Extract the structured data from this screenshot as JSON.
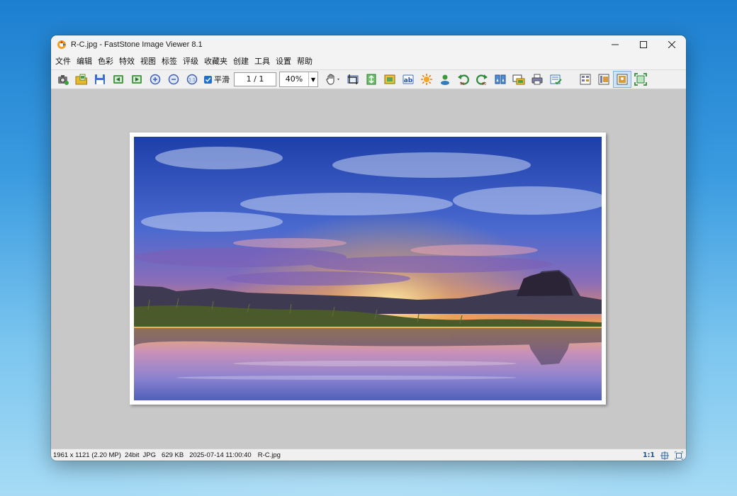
{
  "window": {
    "title": "R-C.jpg  -  FastStone Image Viewer 8.1"
  },
  "menu": [
    "文件",
    "编辑",
    "色彩",
    "特效",
    "视图",
    "标签",
    "评级",
    "收藏夹",
    "创建",
    "工具",
    "设置",
    "帮助"
  ],
  "toolbar": {
    "smooth_label": "平滑",
    "smooth_checked": true,
    "page_indicator": "1 / 1",
    "zoom_value": "40%",
    "buttons": [
      "camera-icon",
      "open-folder-icon",
      "save-icon",
      "previous-icon",
      "next-icon",
      "zoom-in-icon",
      "zoom-out-icon",
      "actual-size-icon",
      "hand-tool-icon",
      "crop-icon",
      "resize-icon",
      "canvas-icon",
      "text-icon",
      "adjust-lighting-icon",
      "person-icon",
      "rotate-left-icon",
      "rotate-right-icon",
      "compare-icon",
      "slideshow-icon",
      "print-icon",
      "email-icon",
      "browser-layout-icon",
      "preview-layout-icon",
      "full-image-layout-icon",
      "fullscreen-icon"
    ]
  },
  "status": {
    "dimensions": "1961 x 1121 (2.20 MP)",
    "bit_depth": "24bit",
    "format": "JPG",
    "size": "629 KB",
    "datetime": "2025-07-14 11:00:40",
    "filename": "R-C.jpg",
    "zoom_ratio": "1:1"
  },
  "colors": {
    "accent": "#1f6fd1",
    "viewer_bg": "#c8c8c8"
  }
}
